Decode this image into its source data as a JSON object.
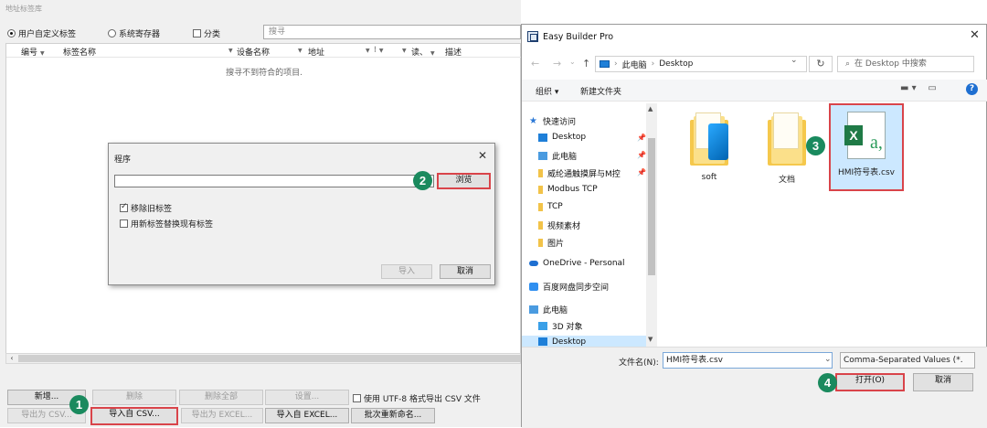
{
  "tag_window": {
    "title": "地址标签库",
    "radios": [
      {
        "label": "用户自定义标签",
        "checked": true
      },
      {
        "label": "系统寄存器",
        "checked": false
      }
    ],
    "category_label": "分类",
    "search_placeholder": "搜寻",
    "columns": [
      {
        "label": "编号"
      },
      {
        "label": "标签名称"
      },
      {
        "label": "设备名称"
      },
      {
        "label": "地址"
      },
      {
        "label": "⁝"
      },
      {
        "label": "读、"
      },
      {
        "label": "描述"
      }
    ],
    "empty_text": "搜寻不到符合的项目.",
    "buttons_row1": {
      "add": "新增...",
      "delete": "删除",
      "delete_all": "删除全部",
      "settings": "设置..."
    },
    "utf8_label": "使用 UTF-8 格式导出 CSV 文件",
    "buttons_row2": {
      "export_csv": "导出为 CSV...",
      "import_csv": "导入自 CSV...",
      "export_excel": "导出为 EXCEL...",
      "import_excel": "导入自 EXCEL...",
      "batch_rename": "批次重新命名..."
    }
  },
  "program_dialog": {
    "title": "程序",
    "close": "✕",
    "browse": "浏览",
    "checks": [
      {
        "label": "移除旧标签",
        "checked": true
      },
      {
        "label": "用新标签替换现有标签",
        "checked": false
      }
    ],
    "import": "导入",
    "cancel": "取消"
  },
  "file_dialog": {
    "title": "Easy Builder Pro",
    "close": "✕",
    "nav": {
      "back": "←",
      "forward": "→",
      "up": "↑"
    },
    "path": [
      "此电脑",
      "›",
      "Desktop"
    ],
    "refresh": "↻",
    "search_placeholder": "在 Desktop 中搜索",
    "toolbar": {
      "organize": "组织 ▾",
      "new_folder": "新建文件夹",
      "help": "?"
    },
    "nav_items": [
      {
        "label": "快速访问",
        "icon": "star-icon",
        "color": "#2b78d6"
      },
      {
        "label": "Desktop",
        "icon": "desktop-icon",
        "color": "#1e7fd8",
        "pinned": true
      },
      {
        "label": "此电脑",
        "icon": "computer-icon",
        "color": "#4a9be0",
        "pinned": true
      },
      {
        "label": "威纶通触摸屏与M控",
        "icon": "folder-icon",
        "color": "#f2c349",
        "pinned": true
      },
      {
        "label": "Modbus TCP",
        "icon": "folder-icon",
        "color": "#f2c349"
      },
      {
        "label": "TCP",
        "icon": "folder-icon",
        "color": "#f2c349"
      },
      {
        "label": "视频素材",
        "icon": "folder-icon",
        "color": "#f2c349"
      },
      {
        "label": "图片",
        "icon": "folder-icon",
        "color": "#f2c349"
      },
      {
        "label": "OneDrive - Personal",
        "icon": "cloud-icon",
        "color": "#1e6fd1"
      },
      {
        "label": "百度网盘同步空间",
        "icon": "baidu-icon",
        "color": "#2f8ff0"
      },
      {
        "label": "此电脑",
        "icon": "computer-icon",
        "color": "#4a9be0"
      },
      {
        "label": "3D 对象",
        "icon": "cube-icon",
        "color": "#3aa0e8"
      },
      {
        "label": "Desktop",
        "icon": "desktop-icon",
        "color": "#1e7fd8"
      }
    ],
    "files": [
      {
        "name": "soft",
        "icon": "folder-icon"
      },
      {
        "name": "文档",
        "icon": "folder-icon"
      },
      {
        "name": "HMI符号表.csv",
        "icon": "excel-csv-icon"
      }
    ],
    "filename_label": "文件名(N):",
    "filename_value": "HMI符号表.csv",
    "filetype_value": "Comma-Separated Values (*.",
    "open": "打开(O)",
    "cancel": "取消"
  },
  "steps": [
    "1",
    "2",
    "3",
    "4"
  ],
  "colors": {
    "highlight": "#d9444a",
    "step_badge": "#1a8a5e",
    "selection": "#cce8ff"
  }
}
